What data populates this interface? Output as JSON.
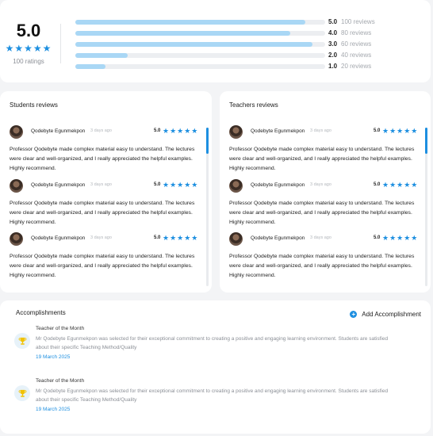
{
  "summary": {
    "average": "5.0",
    "stars": "★★★★★",
    "count_label": "100 ratings",
    "distribution": [
      {
        "star": "5.0",
        "count": "100 reviews",
        "fraction": 0.92
      },
      {
        "star": "4.0",
        "count": "80 reviews",
        "fraction": 0.86
      },
      {
        "star": "3.0",
        "count": "60 reviews",
        "fraction": 0.95
      },
      {
        "star": "2.0",
        "count": "40 reviews",
        "fraction": 0.21
      },
      {
        "star": "1.0",
        "count": "20 reviews",
        "fraction": 0.12
      }
    ]
  },
  "students": {
    "title": "Students reviews",
    "reviews": [
      {
        "name": "Qodebyte Egunmekpon",
        "date": "3 days ago",
        "score": "5.0",
        "stars": "★★★★★",
        "text": "Professor Qodebyte made complex material easy to understand. The lectures were clear and well-organized, and I really appreciated the helpful examples. Highly recommend."
      },
      {
        "name": "Qodebyte Egunmekpon",
        "date": "3 days ago",
        "score": "5.0",
        "stars": "★★★★★",
        "text": "Professor Qodebyte made complex material easy to understand. The lectures were clear and well-organized, and I really appreciated the helpful examples. Highly recommend."
      },
      {
        "name": "Qodebyte Egunmekpon",
        "date": "3 days ago",
        "score": "5.0",
        "stars": "★★★★★",
        "text": "Professor Qodebyte made complex material easy to understand. The lectures were clear and well-organized, and I really appreciated the helpful examples. Highly recommend."
      }
    ]
  },
  "teachers": {
    "title": "Teachers reviews",
    "reviews": [
      {
        "name": "Qodebyte Egunmekpon",
        "date": "3 days ago",
        "score": "5.0",
        "stars": "★★★★★",
        "text": "Professor Qodebyte made complex material easy to understand. The lectures were clear and well-organized, and I really appreciated the helpful examples. Highly recommend."
      },
      {
        "name": "Qodebyte Egunmekpon",
        "date": "3 days ago",
        "score": "5.0",
        "stars": "★★★★★",
        "text": "Professor Qodebyte made complex material easy to understand. The lectures were clear and well-organized, and I really appreciated the helpful examples. Highly recommend."
      },
      {
        "name": "Qodebyte Egunmekpon",
        "date": "3 days ago",
        "score": "5.0",
        "stars": "★★★★★",
        "text": "Professor Qodebyte made complex material easy to understand. The lectures were clear and well-organized, and I really appreciated the helpful examples. Highly recommend."
      }
    ]
  },
  "accomplishments": {
    "title": "Accomplishments",
    "add_label": "Add Accomplishment",
    "add_icon": "plus-circle-icon",
    "items": [
      {
        "icon": "trophy-icon",
        "name": "Teacher of the Month",
        "description": "Mr Qodebyte Egunmekpon was selected for their exceptional commitment to creating a positive and engaging learning environment. Students are satisfied about their specific Teaching Method/Quality",
        "date": "19 March 2025"
      },
      {
        "icon": "trophy-icon",
        "name": "Teacher of the Month",
        "description": "Mr Qodebyte Egunmekpon was selected for their exceptional commitment to creating a positive and engaging learning environment. Students are satisfied about their specific Teaching Method/Quality",
        "date": "19 March 2025"
      }
    ]
  },
  "colors": {
    "accent": "#1d8fe0",
    "bar_fill": "#a9d7f5",
    "trophy": "#f2c200"
  }
}
